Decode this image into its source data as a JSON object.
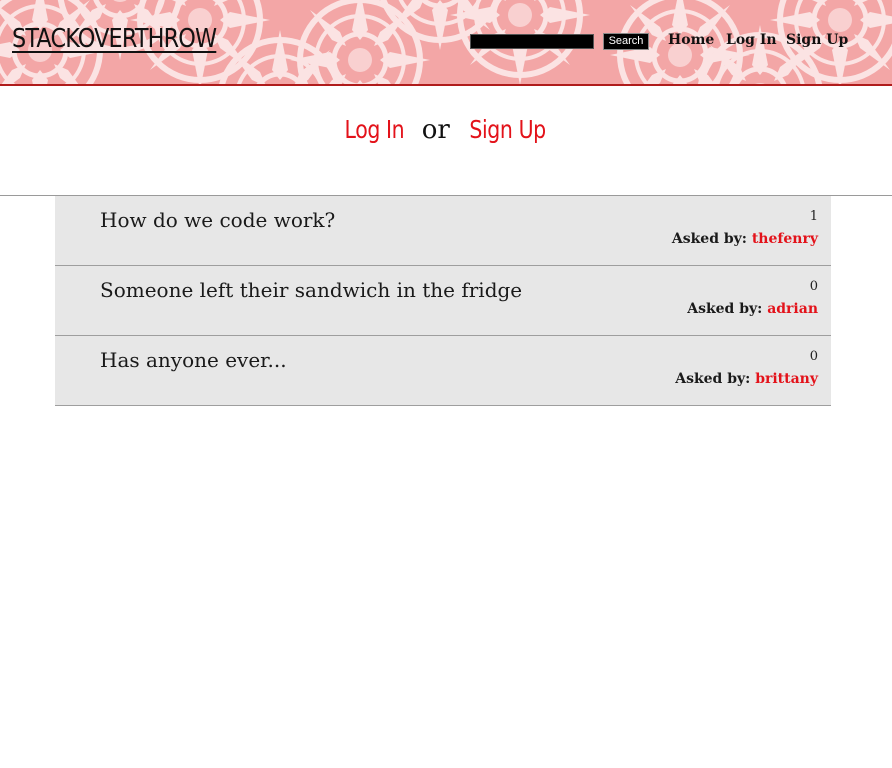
{
  "header": {
    "logo": "STACKOVERTHROW",
    "search": {
      "value": "",
      "placeholder": ""
    },
    "search_button": "Search",
    "nav": {
      "home": "Home",
      "login": "Log In",
      "signup": "Sign Up"
    }
  },
  "auth_prompt": {
    "login": "Log In",
    "or": "or",
    "signup": "Sign Up"
  },
  "questions": [
    {
      "title": "How do we code work?",
      "count": "1",
      "asked_by_label": "Asked by:",
      "user": "thefenry"
    },
    {
      "title": "Someone left their sandwich in the fridge",
      "count": "0",
      "asked_by_label": "Asked by:",
      "user": "adrian"
    },
    {
      "title": "Has anyone ever...",
      "count": "0",
      "asked_by_label": "Asked by:",
      "user": "brittany"
    }
  ],
  "colors": {
    "accent": "#e3121a",
    "banner": "#f3a6a6",
    "banner_border": "#b01c1c",
    "row_bg": "#e7e7e7"
  }
}
